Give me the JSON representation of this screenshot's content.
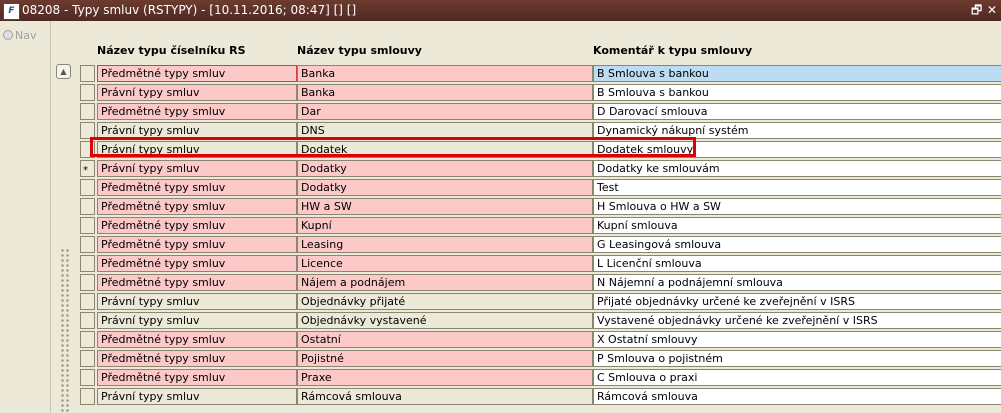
{
  "window": {
    "title": "08208 - Typy smluv (RSTYPY) - [10.11.2016; 08:47] [] []",
    "app_icon_text": "F",
    "restore_glyph": "🗗",
    "close_glyph": "✕"
  },
  "toolbar": {
    "nav_label": "Nav"
  },
  "table": {
    "headers": [
      "Název typu číselníku RS",
      "Název typu smlouvy",
      "Komentář k typu smlouvy"
    ],
    "rows": [
      {
        "marker": "",
        "c1": "Předmětné typy smluv",
        "c2": "Banka",
        "c3": "B Smlouva s bankou",
        "style": "current"
      },
      {
        "marker": "",
        "c1": "Právní typy smluv",
        "c2": "Banka",
        "c3": "B Smlouva s bankou",
        "style": "pink"
      },
      {
        "marker": "",
        "c1": "Předmětné typy smluv",
        "c2": "Dar",
        "c3": "D Darovací smlouva",
        "style": "pink"
      },
      {
        "marker": "",
        "c1": "Právní typy smluv",
        "c2": "DNS",
        "c3": "Dynamický nákupní systém",
        "style": "grey"
      },
      {
        "marker": "",
        "c1": "Právní typy smluv",
        "c2": "Dodatek",
        "c3": "Dodatek smlouvy",
        "style": "grey"
      },
      {
        "marker": "*",
        "c1": "Právní typy smluv",
        "c2": "Dodatky",
        "c3": "Dodatky ke smlouvám",
        "style": "pink"
      },
      {
        "marker": "",
        "c1": "Předmětné typy smluv",
        "c2": "Dodatky",
        "c3": "Test",
        "style": "pink"
      },
      {
        "marker": "",
        "c1": "Předmětné typy smluv",
        "c2": "HW a SW",
        "c3": "H Smlouva o HW a SW",
        "style": "pink"
      },
      {
        "marker": "",
        "c1": "Předmětné typy smluv",
        "c2": "Kupní",
        "c3": "Kupní smlouva",
        "style": "pink"
      },
      {
        "marker": "",
        "c1": "Předmětné typy smluv",
        "c2": "Leasing",
        "c3": "G Leasingová smlouva",
        "style": "pink"
      },
      {
        "marker": "",
        "c1": "Předmětné typy smluv",
        "c2": "Licence",
        "c3": "L Licenční smlouva",
        "style": "pink"
      },
      {
        "marker": "",
        "c1": "Předmětné typy smluv",
        "c2": "Nájem a podnájem",
        "c3": "N Nájemní a podnájemní smlouva",
        "style": "pink"
      },
      {
        "marker": "",
        "c1": "Právní typy smluv",
        "c2": "Objednávky přijaté",
        "c3": "Přijaté objednávky určené ke zveřejnění v ISRS",
        "style": "grey"
      },
      {
        "marker": "",
        "c1": "Právní typy smluv",
        "c2": "Objednávky vystavené",
        "c3": "Vystavené objednávky určené ke zveřejnění v ISRS",
        "style": "grey"
      },
      {
        "marker": "",
        "c1": "Předmětné typy smluv",
        "c2": "Ostatní",
        "c3": "X Ostatní smlouvy",
        "style": "pink"
      },
      {
        "marker": "",
        "c1": "Předmětné typy smluv",
        "c2": "Pojistné",
        "c3": "P Smlouva o pojistném",
        "style": "pink"
      },
      {
        "marker": "",
        "c1": "Předmětné typy smluv",
        "c2": "Praxe",
        "c3": "C Smlouva o praxi",
        "style": "pink"
      },
      {
        "marker": "",
        "c1": "Právní typy smluv",
        "c2": "Rámcová smlouva",
        "c3": "Rámcová smlouva",
        "style": "grey"
      }
    ]
  },
  "colors": {
    "titlebar": "#5e3228",
    "pink": "#fdc8c8",
    "grey": "#ece9d8",
    "selected_blue": "#bcdcf4",
    "highlight_red": "#e00000"
  },
  "icons": {
    "nav": "radio-dot-icon",
    "scroll_up": "triangle-up-icon",
    "restore": "window-restore-icon",
    "close": "close-icon"
  }
}
